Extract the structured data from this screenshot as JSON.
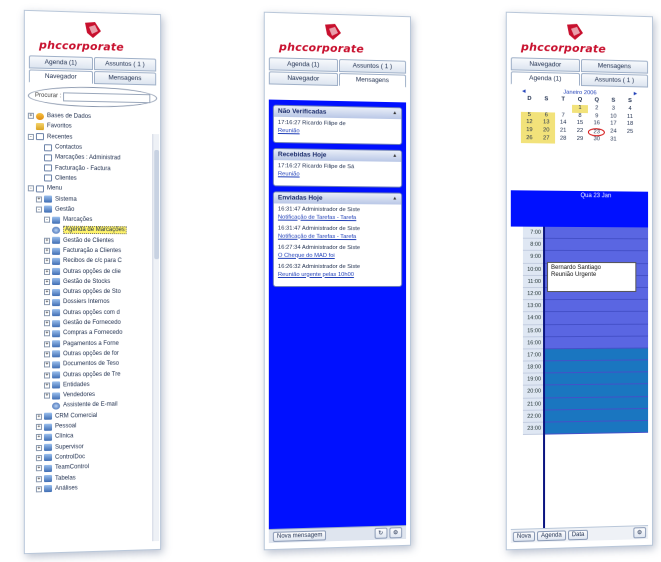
{
  "brand": {
    "logo_text": "phccorporate",
    "accent": "#c8102e"
  },
  "panel1": {
    "tabs_top": [
      "Agenda (1)",
      "Assuntos ( 1 )"
    ],
    "tabs_bottom": [
      "Navegador",
      "Mensagens"
    ],
    "search_label": "Procurar :",
    "search_value": "",
    "tree": [
      {
        "label": "Bases de Dados",
        "indent": 0,
        "exp": "+",
        "icon": "db"
      },
      {
        "label": "Favoritos",
        "indent": 0,
        "exp": "",
        "icon": "folder"
      },
      {
        "label": "Recentes",
        "indent": 0,
        "exp": "-",
        "icon": "doc"
      },
      {
        "label": "Contactos",
        "indent": 1,
        "exp": "",
        "icon": "doc"
      },
      {
        "label": "Marcações : Administrad",
        "indent": 1,
        "exp": "",
        "icon": "doc"
      },
      {
        "label": "Facturação - Factura",
        "indent": 1,
        "exp": "",
        "icon": "doc"
      },
      {
        "label": "Clientes",
        "indent": 1,
        "exp": "",
        "icon": "doc"
      },
      {
        "label": "Menu",
        "indent": 0,
        "exp": "-",
        "icon": "doc"
      },
      {
        "label": "Sistema",
        "indent": 1,
        "exp": "+",
        "icon": "fld"
      },
      {
        "label": "Gestão",
        "indent": 1,
        "exp": "-",
        "icon": "fld"
      },
      {
        "label": "Marcações",
        "indent": 2,
        "exp": "-",
        "icon": "fld"
      },
      {
        "label": "Agenda de Marcações",
        "indent": 2,
        "exp": "",
        "icon": "ball",
        "selected": true
      },
      {
        "label": "Gestão de Clientes",
        "indent": 2,
        "exp": "+",
        "icon": "fld"
      },
      {
        "label": "Facturação a Clientes",
        "indent": 2,
        "exp": "+",
        "icon": "fld"
      },
      {
        "label": "Recibos de c/c para C",
        "indent": 2,
        "exp": "+",
        "icon": "fld"
      },
      {
        "label": "Outras opções de clie",
        "indent": 2,
        "exp": "+",
        "icon": "fld"
      },
      {
        "label": "Gestão de Stocks",
        "indent": 2,
        "exp": "+",
        "icon": "fld"
      },
      {
        "label": "Outras opções de Sto",
        "indent": 2,
        "exp": "+",
        "icon": "fld"
      },
      {
        "label": "Dossiers Internos",
        "indent": 2,
        "exp": "+",
        "icon": "fld"
      },
      {
        "label": "Outras opções com d",
        "indent": 2,
        "exp": "+",
        "icon": "fld"
      },
      {
        "label": "Gestão de Fornecedo",
        "indent": 2,
        "exp": "+",
        "icon": "fld"
      },
      {
        "label": "Compras a Fornecedo",
        "indent": 2,
        "exp": "+",
        "icon": "fld"
      },
      {
        "label": "Pagamentos a Forne",
        "indent": 2,
        "exp": "+",
        "icon": "fld"
      },
      {
        "label": "Outras opções de for",
        "indent": 2,
        "exp": "+",
        "icon": "fld"
      },
      {
        "label": "Documentos de Teso",
        "indent": 2,
        "exp": "+",
        "icon": "fld"
      },
      {
        "label": "Outras opções de Tre",
        "indent": 2,
        "exp": "+",
        "icon": "fld"
      },
      {
        "label": "Entidades",
        "indent": 2,
        "exp": "+",
        "icon": "fld"
      },
      {
        "label": "Vendedores",
        "indent": 2,
        "exp": "+",
        "icon": "fld"
      },
      {
        "label": "Assistente de E-mail",
        "indent": 2,
        "exp": "",
        "icon": "ball"
      },
      {
        "label": "CRM Comercial",
        "indent": 1,
        "exp": "+",
        "icon": "fld"
      },
      {
        "label": "Pessoal",
        "indent": 1,
        "exp": "+",
        "icon": "fld"
      },
      {
        "label": "Clínica",
        "indent": 1,
        "exp": "+",
        "icon": "fld"
      },
      {
        "label": "Supervisor",
        "indent": 1,
        "exp": "+",
        "icon": "fld"
      },
      {
        "label": "ControlDoc",
        "indent": 1,
        "exp": "+",
        "icon": "fld"
      },
      {
        "label": "TeamControl",
        "indent": 1,
        "exp": "+",
        "icon": "fld"
      },
      {
        "label": "Tabelas",
        "indent": 1,
        "exp": "+",
        "icon": "fld"
      },
      {
        "label": "Análises",
        "indent": 1,
        "exp": "+",
        "icon": "fld"
      }
    ]
  },
  "panel2": {
    "tabs_top": [
      "Agenda (1)",
      "Assuntos ( 1 )"
    ],
    "tabs_bottom": [
      "Navegador",
      "Mensagens"
    ],
    "boxes": [
      {
        "title": "Não Verificadas",
        "messages": [
          {
            "text": "17:16:27 Ricardo Filipe de",
            "link": "Reunião"
          }
        ]
      },
      {
        "title": "Recebidas Hoje",
        "messages": [
          {
            "text": "17:16:27 Ricardo Filipe de Sá",
            "link": "Reunião"
          }
        ]
      },
      {
        "title": "Enviadas Hoje",
        "messages": [
          {
            "text": "16:31:47 Administrador de Siste",
            "link": "Notificação de Tarefas - Tarefa"
          },
          {
            "text": "16:31:47 Administrador de Siste",
            "link": "Notificação de Tarefas - Tarefa"
          },
          {
            "text": "16:27:34 Administrador de Siste",
            "link": "O Cheque do MAD foi"
          },
          {
            "text": "16:26:32 Administrador de Siste",
            "link": "Reunião urgente pelas 10h00"
          }
        ]
      }
    ],
    "new_message_label": "Nova mensagem"
  },
  "panel3": {
    "tabs_top": [
      "Navegador",
      "Mensagens"
    ],
    "tabs_bottom": [
      "Agenda (1)",
      "Assuntos ( 1 )"
    ],
    "calendar": {
      "month": "Janeiro 2006",
      "weekdays": [
        "D",
        "S",
        "T",
        "Q",
        "Q",
        "S",
        "S"
      ],
      "days": [
        "",
        "",
        "",
        "1",
        "2",
        "3",
        "4",
        "5",
        "6",
        "7",
        "8",
        "9",
        "10",
        "11",
        "12",
        "13",
        "14",
        "15",
        "16",
        "17",
        "18",
        "19",
        "20",
        "21",
        "22",
        "23",
        "24",
        "25",
        "26",
        "27",
        "28",
        "29",
        "30",
        "31",
        "",
        "",
        "",
        "",
        "",
        "",
        "",
        "",
        ""
      ],
      "highlighted": [
        "1",
        "5",
        "6",
        "12",
        "13",
        "19",
        "20",
        "26",
        "27"
      ],
      "today": "23"
    },
    "day_label": "Qua 23 Jan",
    "hours": [
      "7:00",
      "8:00",
      "9:00",
      "10:00",
      "11:00",
      "12:00",
      "13:00",
      "14:00",
      "15:00",
      "16:00",
      "17:00",
      "18:00",
      "19:00",
      "20:00",
      "21:00",
      "22:00",
      "23:00"
    ],
    "appointment": {
      "line1": "Bernardo Santiago",
      "line2": "Reunião Urgente"
    },
    "buttons": {
      "new": "Nova",
      "agenda": "Agenda",
      "date": "Data"
    }
  }
}
